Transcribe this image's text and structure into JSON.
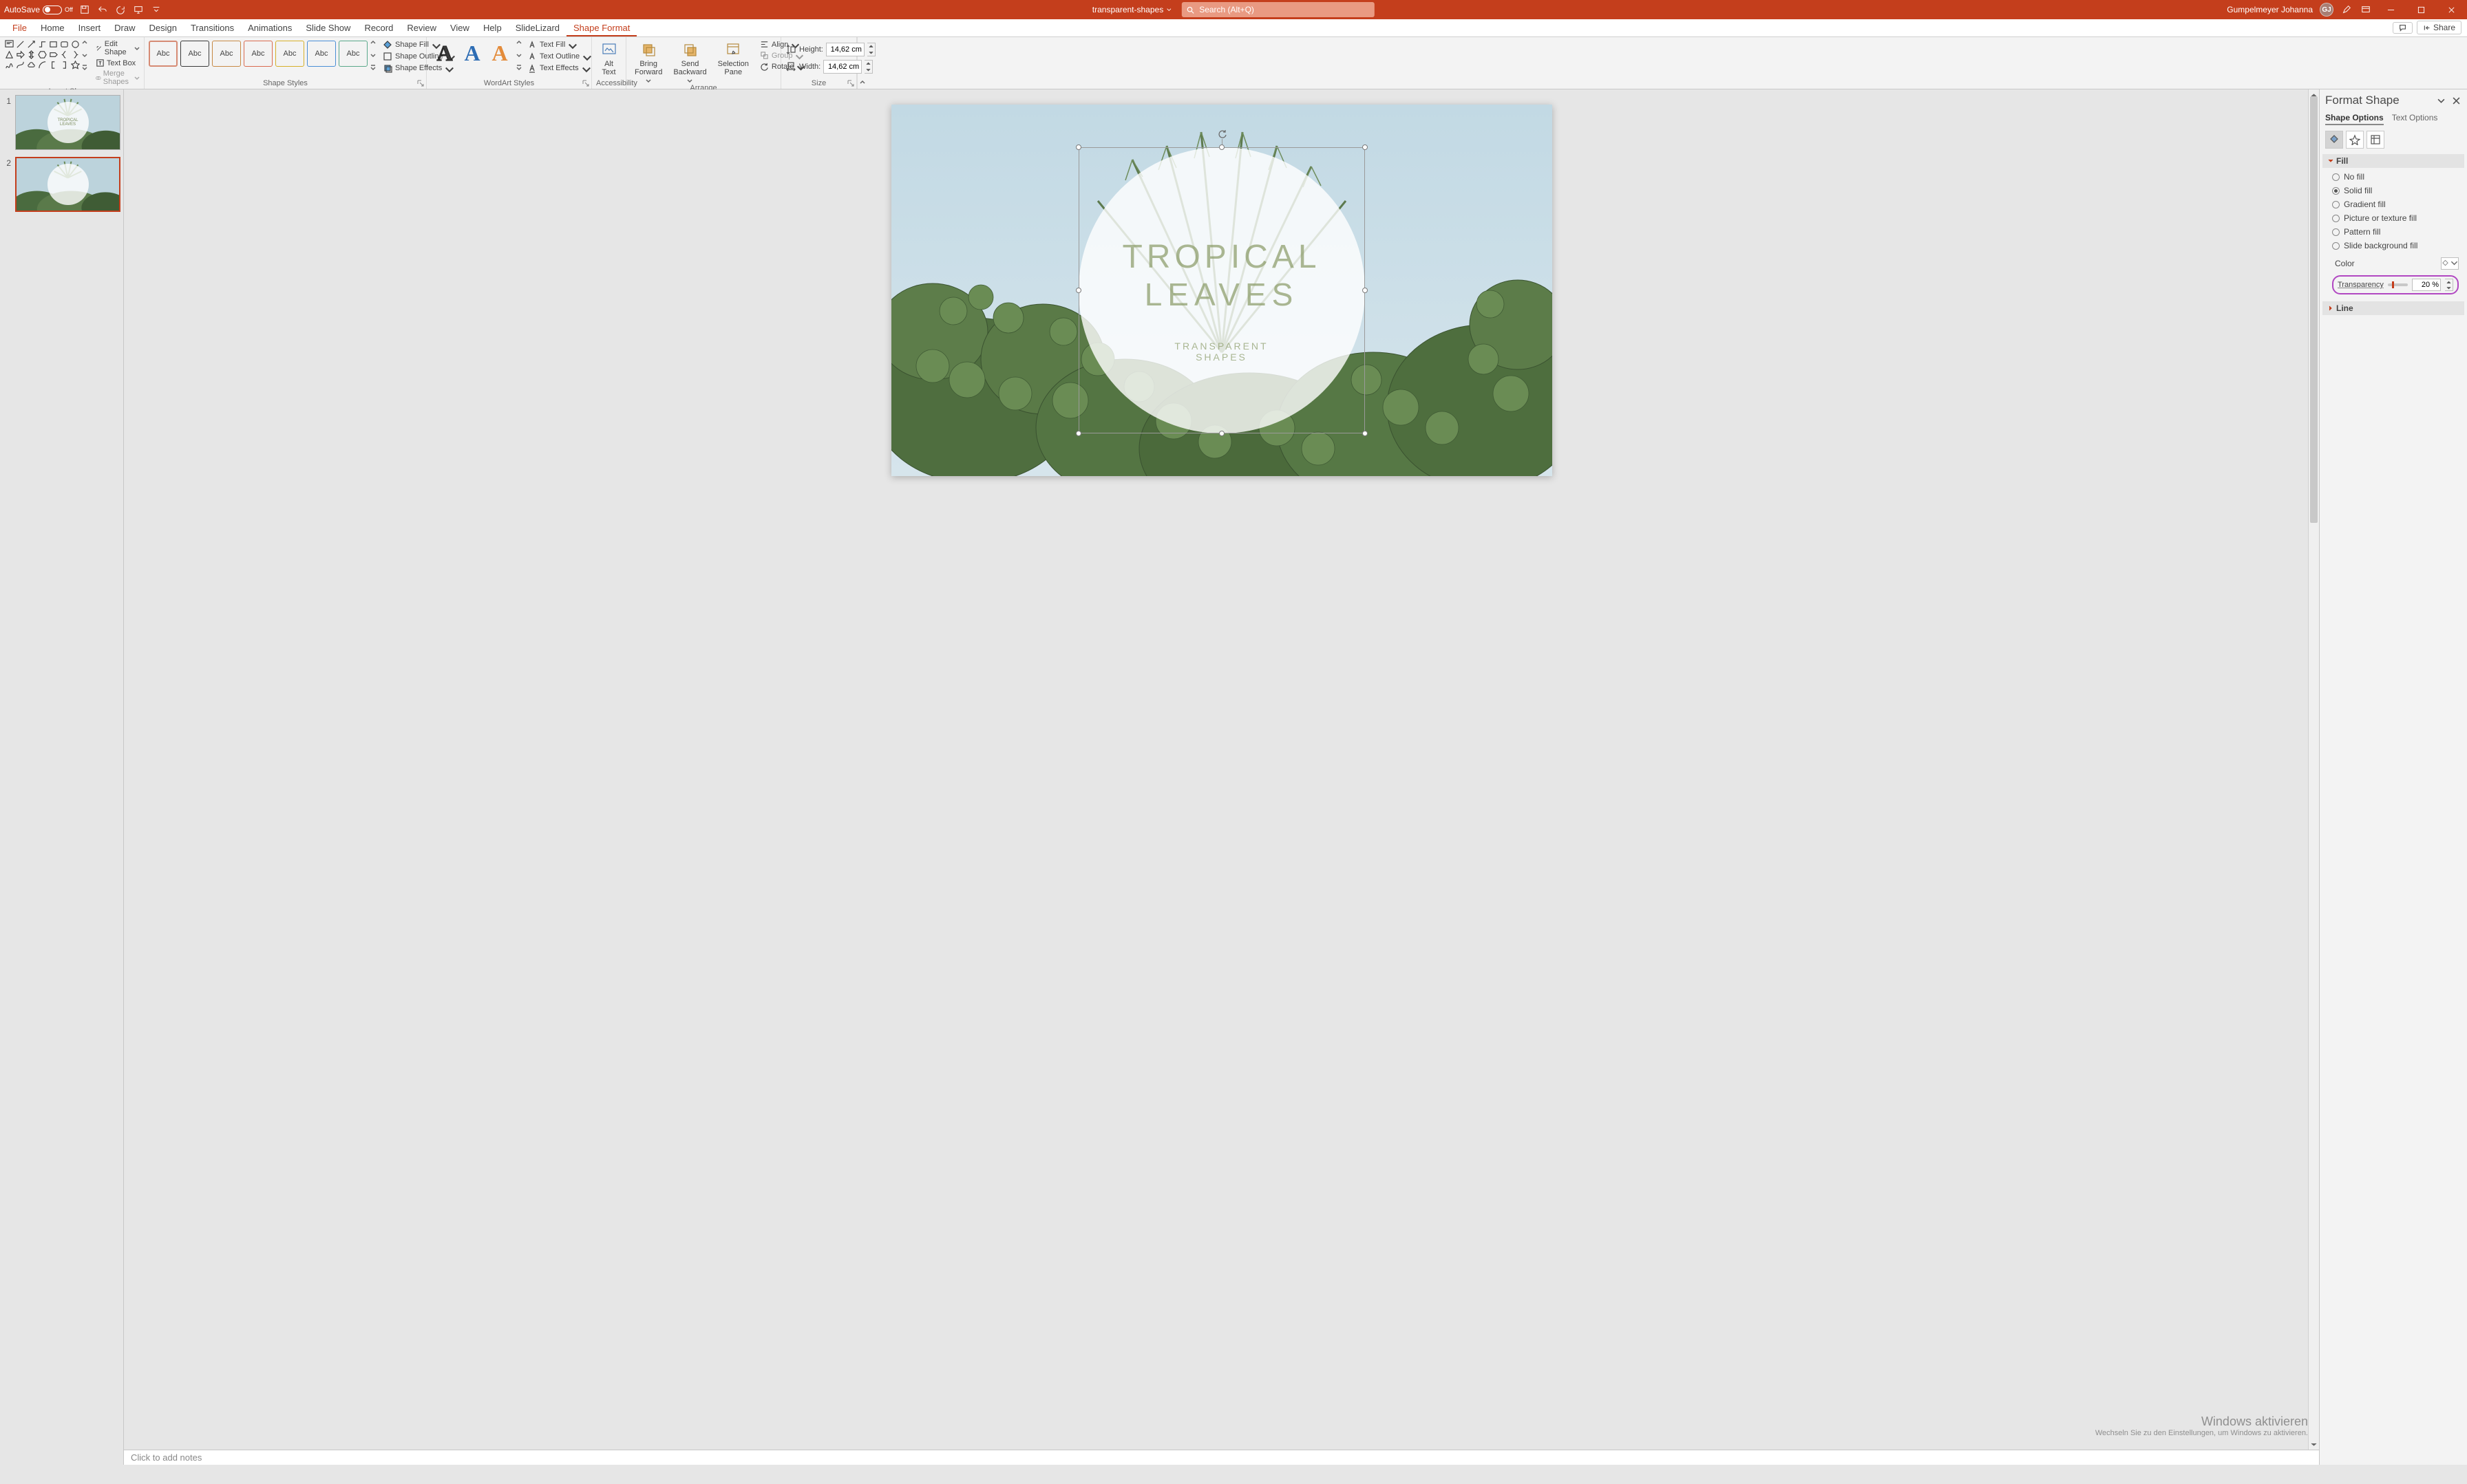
{
  "titlebar": {
    "autosave_label": "AutoSave",
    "autosave_state": "Off",
    "doc_title": "transparent-shapes",
    "search_placeholder": "Search (Alt+Q)",
    "user_name": "Gumpelmeyer Johanna",
    "user_initials": "GJ"
  },
  "tabs": {
    "file": "File",
    "items": [
      "Home",
      "Insert",
      "Draw",
      "Design",
      "Transitions",
      "Animations",
      "Slide Show",
      "Record",
      "Review",
      "View",
      "Help",
      "SlideLizard",
      "Shape Format"
    ],
    "active": "Shape Format",
    "comments_btn": "",
    "share_btn": "Share"
  },
  "ribbon": {
    "insert_shapes": {
      "label": "Insert Shapes",
      "edit_shape": "Edit Shape",
      "text_box": "Text Box",
      "merge_shapes": "Merge Shapes"
    },
    "shape_styles": {
      "label": "Shape Styles",
      "swatch_text": "Abc",
      "shape_fill": "Shape Fill",
      "shape_outline": "Shape Outline",
      "shape_effects": "Shape Effects"
    },
    "wordart": {
      "label": "WordArt Styles",
      "text_fill": "Text Fill",
      "text_outline": "Text Outline",
      "text_effects": "Text Effects"
    },
    "accessibility": {
      "label": "Accessibility",
      "alt_text": "Alt\nText"
    },
    "arrange": {
      "label": "Arrange",
      "bring_forward": "Bring\nForward",
      "send_backward": "Send\nBackward",
      "selection_pane": "Selection\nPane",
      "align": "Align",
      "group": "Group",
      "rotate": "Rotate"
    },
    "size": {
      "label": "Size",
      "height_label": "Height:",
      "height_value": "14,62 cm",
      "width_label": "Width:",
      "width_value": "14,62 cm"
    }
  },
  "thumbnails": [
    {
      "num": "1",
      "title1": "TROPICAL",
      "title2": "LEAVES",
      "sub": "TRANSPARENT SHAPES"
    },
    {
      "num": "2"
    }
  ],
  "slide_text": {
    "t1": "TROPICAL",
    "t2": "LEAVES",
    "sub1": "TRANSPARENT",
    "sub2": "SHAPES"
  },
  "notes_placeholder": "Click to add notes",
  "watermark": {
    "l1": "Windows aktivieren",
    "l2": "Wechseln Sie zu den Einstellungen, um Windows zu aktivieren."
  },
  "format_shape": {
    "title": "Format Shape",
    "tab_shape": "Shape Options",
    "tab_text": "Text Options",
    "section_fill": "Fill",
    "no_fill": "No fill",
    "solid_fill": "Solid fill",
    "gradient_fill": "Gradient fill",
    "picture_fill": "Picture or texture fill",
    "pattern_fill": "Pattern fill",
    "slide_bg_fill": "Slide background fill",
    "color_label": "Color",
    "transparency_label": "Transparency",
    "transparency_value": "20 %",
    "section_line": "Line"
  }
}
